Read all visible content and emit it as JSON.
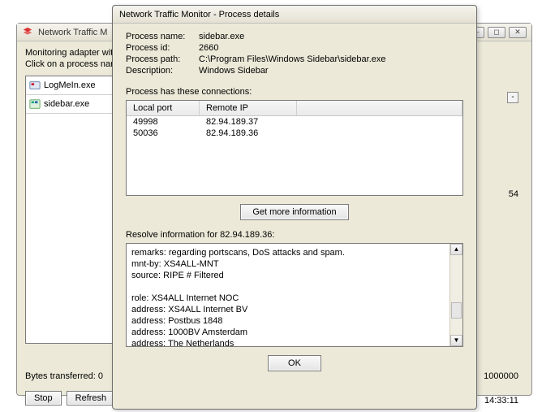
{
  "parent": {
    "title": "Network Traffic M",
    "line1": "Monitoring adapter with",
    "line2": "Click on a process nam",
    "processes": [
      {
        "name": "LogMeIn.exe",
        "icon": "app-blue-red"
      },
      {
        "name": "sidebar.exe",
        "icon": "app-window"
      }
    ],
    "bytes_label": "Bytes transferred:",
    "bytes_value": "0",
    "stop_label": "Stop",
    "refresh_label": "Refresh",
    "right_small_btn": "-",
    "right_val1": "54",
    "right_val2": "1000000",
    "right_val3": "14:33:11"
  },
  "dialog": {
    "title": "Network Traffic Monitor - Process details",
    "labels": {
      "process_name": "Process name:",
      "process_id": "Process id:",
      "process_path": "Process path:",
      "description": "Description:"
    },
    "values": {
      "process_name": "sidebar.exe",
      "process_id": "2660",
      "process_path": "C:\\Program Files\\Windows Sidebar\\sidebar.exe",
      "description": "Windows Sidebar"
    },
    "connections_label": "Process has these connections:",
    "columns": {
      "local_port": "Local port",
      "remote_ip": "Remote IP"
    },
    "connections": [
      {
        "local_port": "49998",
        "remote_ip": "82.94.189.37"
      },
      {
        "local_port": "50036",
        "remote_ip": "82.94.189.36"
      }
    ],
    "get_more_label": "Get more information",
    "resolve_label": "Resolve information for 82.94.189.36:",
    "resolve_lines": [
      "remarks: regarding portscans, DoS attacks and spam.",
      "mnt-by: XS4ALL-MNT",
      "source: RIPE # Filtered",
      "",
      "role: XS4ALL Internet NOC",
      "address: XS4ALL Internet BV",
      "address: Postbus 1848",
      "address: 1000BV Amsterdam",
      "address: The Netherlands"
    ],
    "ok_label": "OK"
  }
}
